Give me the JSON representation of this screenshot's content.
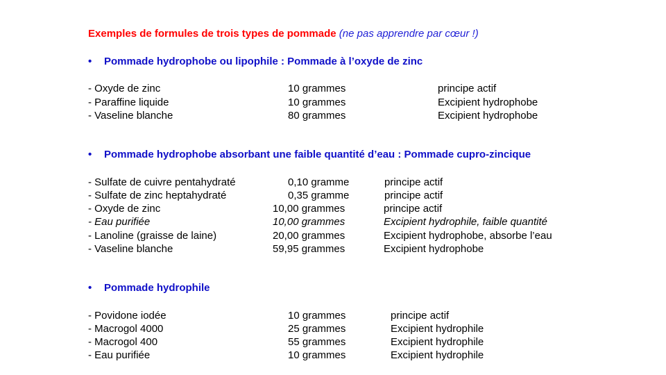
{
  "title": {
    "main": "Exemples de formules de trois types de pommade",
    "note": "(ne pas apprendre par cœur !)"
  },
  "bullet": "•",
  "sections": [
    {
      "heading": "Pommade hydrophobe ou lipophile : Pommade à l’oxyde de zinc",
      "rows": [
        {
          "ingredient": "- Oxyde de zinc",
          "quantity": "10 grammes",
          "role": "principe actif"
        },
        {
          "ingredient": "- Paraffine liquide",
          "quantity": "10 grammes",
          "role": "Excipient hydrophobe"
        },
        {
          "ingredient": "- Vaseline blanche",
          "quantity": "80 grammes",
          "role": "Excipient hydrophobe"
        }
      ]
    },
    {
      "heading": "Pommade hydrophobe absorbant une faible quantité d’eau : Pommade cupro-zincique",
      "rows": [
        {
          "ingredient": "- Sulfate de cuivre pentahydraté",
          "quantity": "0,10 gramme",
          "role": "principe actif"
        },
        {
          "ingredient": "- Sulfate de zinc heptahydraté",
          "quantity": "0,35 gramme",
          "role": "principe actif"
        },
        {
          "ingredient": "- Oxyde de zinc",
          "quantity": "10,00 grammes",
          "role": "principe actif"
        },
        {
          "ingredient": "- Eau purifiée",
          "quantity": "10,00 grammes",
          "role": "Excipient hydrophile, faible quantité"
        },
        {
          "ingredient": "- Lanoline (graisse de laine)",
          "quantity": "20,00 grammes",
          "role": "Excipient hydrophobe,  absorbe l’eau"
        },
        {
          "ingredient": "- Vaseline blanche",
          "quantity": "59,95 grammes",
          "role": "Excipient hydrophobe"
        }
      ]
    },
    {
      "heading": "Pommade hydrophile",
      "rows": [
        {
          "ingredient": "- Povidone iodée",
          "quantity": "10 grammes",
          "role": "principe actif"
        },
        {
          "ingredient": "- Macrogol 4000",
          "quantity": "25 grammes",
          "role": "Excipient hydrophile"
        },
        {
          "ingredient": "- Macrogol 400",
          "quantity": "55 grammes",
          "role": "Excipient hydrophile"
        },
        {
          "ingredient": "- Eau purifiée",
          "quantity": "10 grammes",
          "role": "Excipient hydrophile"
        }
      ]
    }
  ]
}
